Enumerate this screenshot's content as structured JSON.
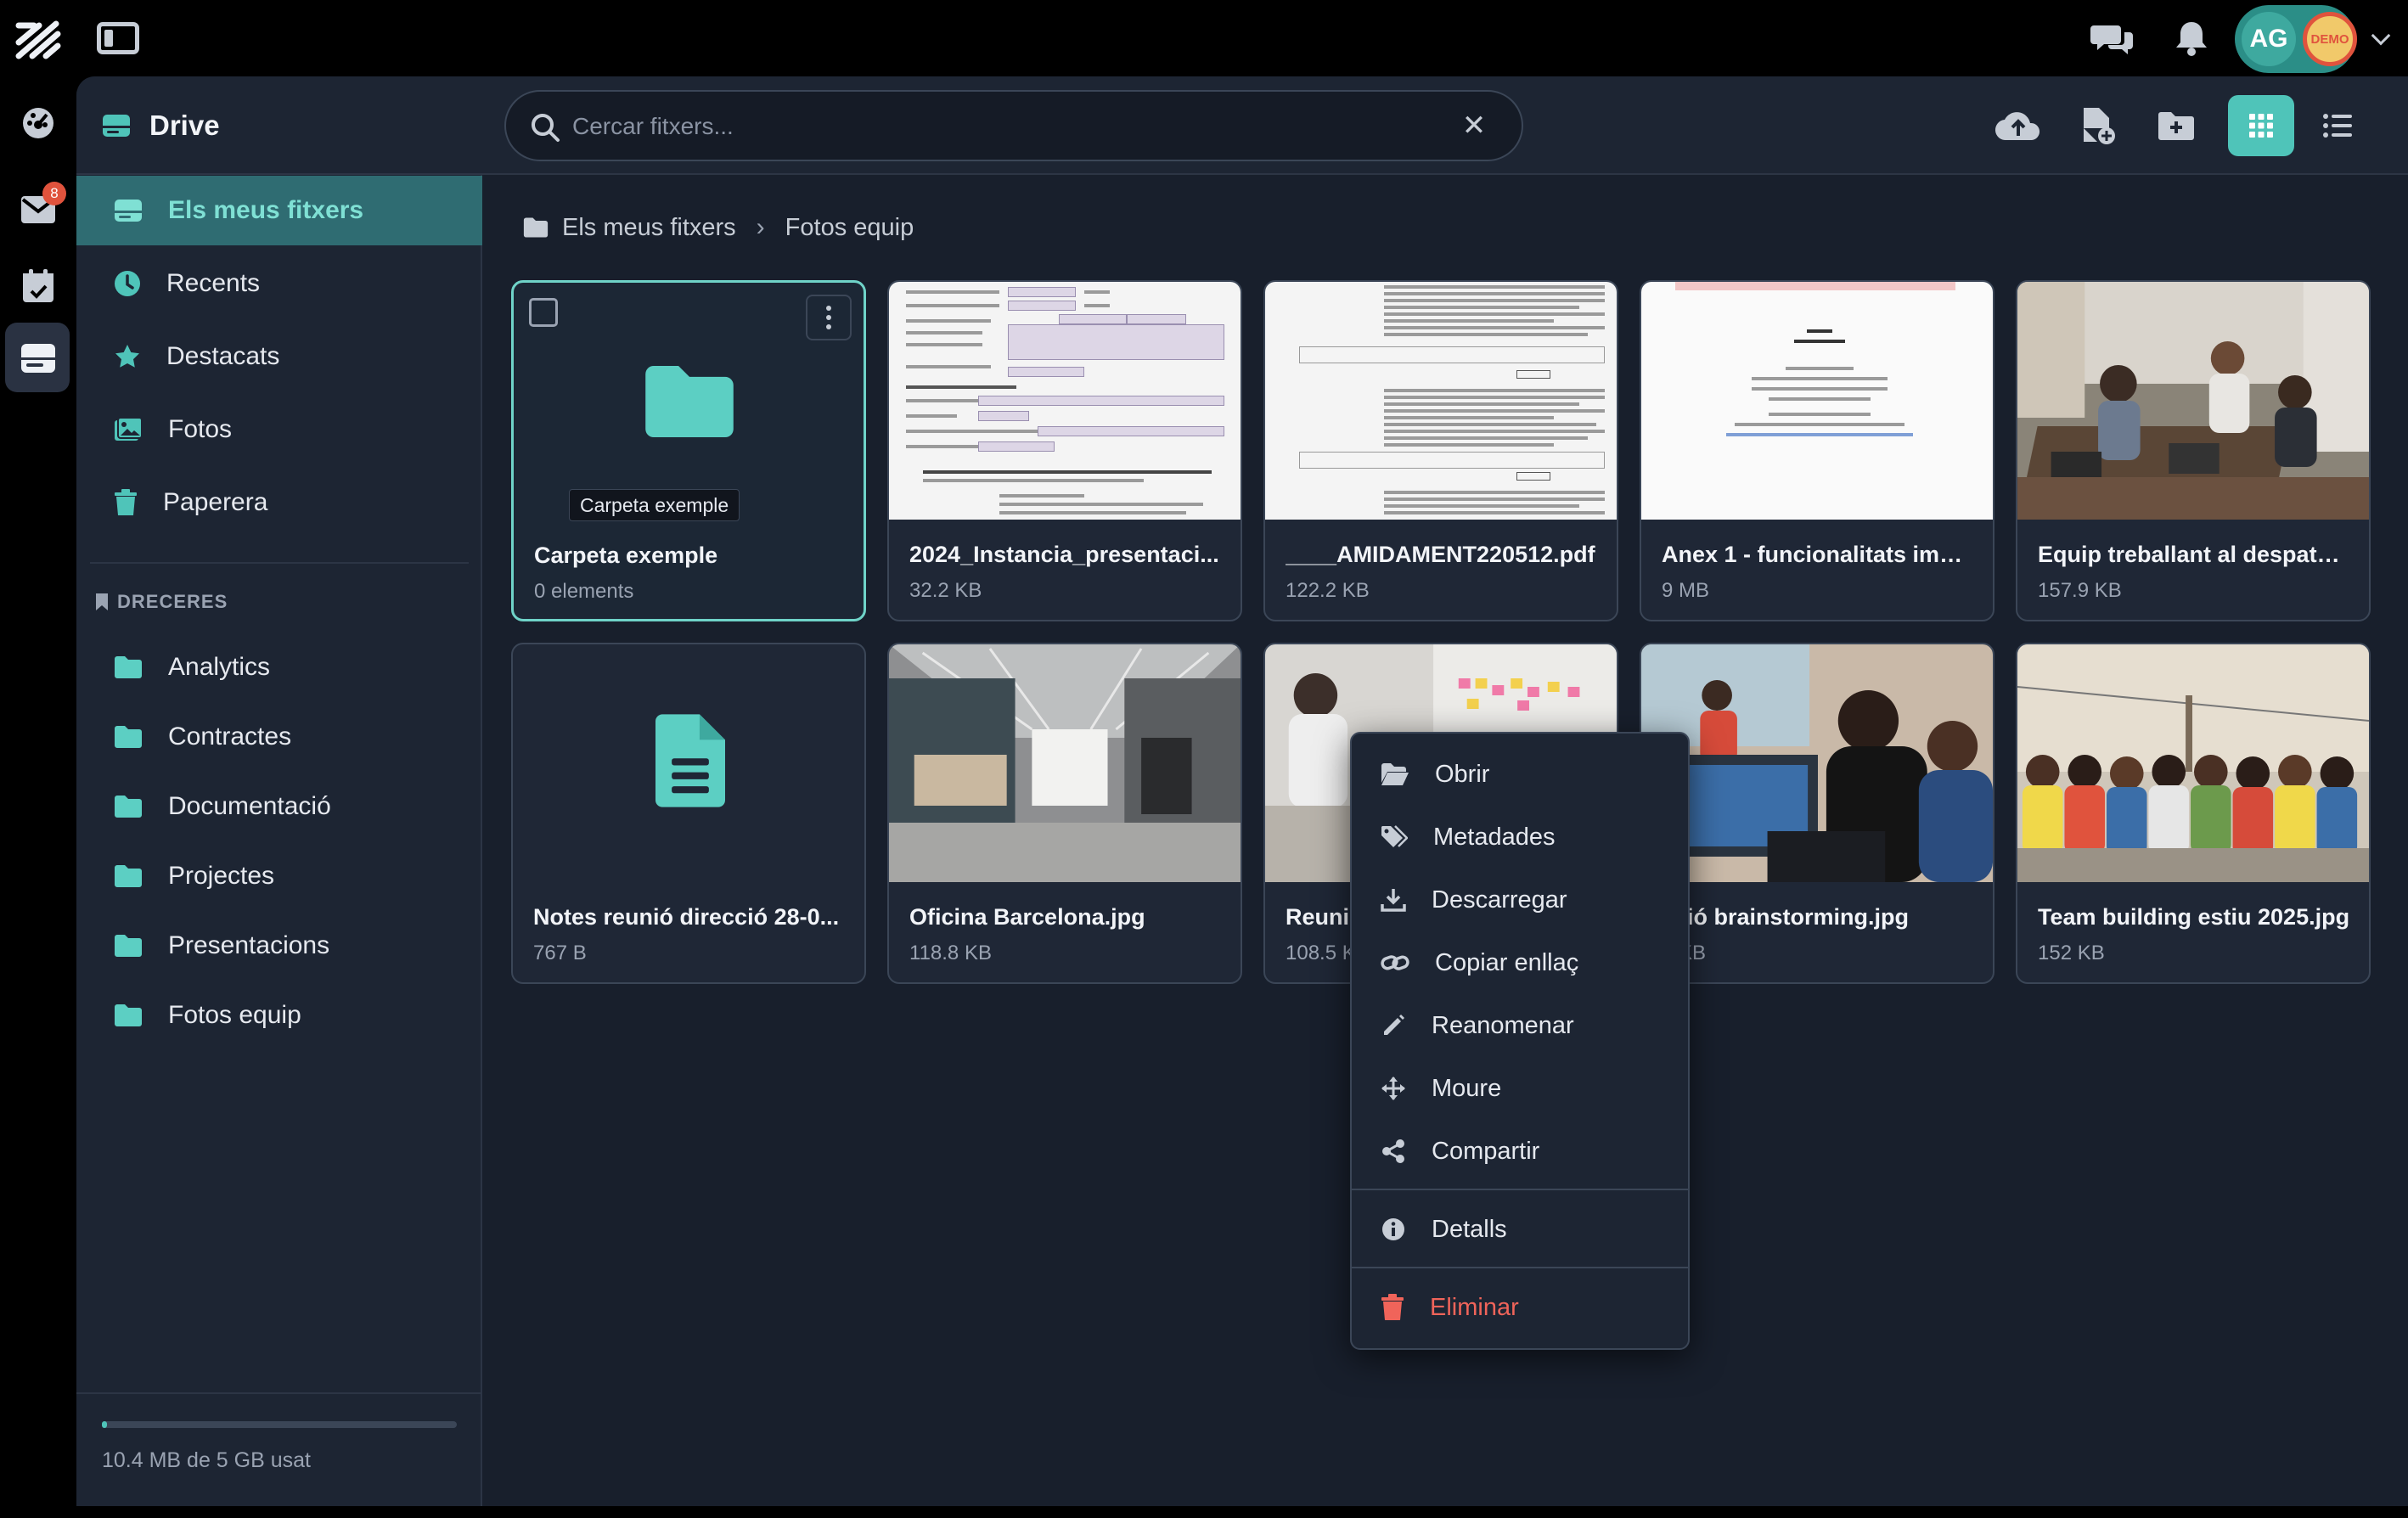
{
  "topbar": {
    "avatar_initials": "AG",
    "demo_label": "DEMO"
  },
  "rail": {
    "mail_badge": "8"
  },
  "header": {
    "app_title": "Drive",
    "search_placeholder": "Cercar fitxers...",
    "search_value": ""
  },
  "sidebar": {
    "items": [
      {
        "label": "Els meus fitxers",
        "icon": "drive-icon",
        "active": true
      },
      {
        "label": "Recents",
        "icon": "clock-icon"
      },
      {
        "label": "Destacats",
        "icon": "star-icon"
      },
      {
        "label": "Fotos",
        "icon": "photos-icon"
      },
      {
        "label": "Paperera",
        "icon": "trash-icon"
      }
    ],
    "shortcuts_heading": "DRECERES",
    "shortcuts": [
      "Analytics",
      "Contractes",
      "Documentació",
      "Projectes",
      "Presentacions",
      "Fotos equip"
    ],
    "quota_text": "10.4 MB de 5 GB usat",
    "quota_fraction": 0.002
  },
  "breadcrumb": [
    "Els meus fitxers",
    "Fotos equip"
  ],
  "files": [
    {
      "name": "Carpeta exemple",
      "meta": "0 elements",
      "kind": "folder"
    },
    {
      "name": "2024_Instancia_presentaci...",
      "meta": "32.2 KB",
      "kind": "doc"
    },
    {
      "name": "____AMIDAMENT220512.pdf",
      "meta": "122.2 KB",
      "kind": "doc"
    },
    {
      "name": "Anex 1 - funcionalitats impl...",
      "meta": "9 MB",
      "kind": "doc"
    },
    {
      "name": "Equip treballant al despatx.j...",
      "meta": "157.9 KB",
      "kind": "photo"
    },
    {
      "name": "Notes reunió direcció 28-0...",
      "meta": "767 B",
      "kind": "note"
    },
    {
      "name": "Oficina Barcelona.jpg",
      "meta": "118.8 KB",
      "kind": "photo"
    },
    {
      "name": "Reunic",
      "meta": "108.5 K",
      "kind": "photo"
    },
    {
      "name": "ssió brainstorming.jpg",
      "meta": "3 KB",
      "kind": "photo"
    },
    {
      "name": "Team building estiu 2025.jpg",
      "meta": "152 KB",
      "kind": "photo"
    }
  ],
  "tooltip": "Carpeta exemple",
  "context_menu": {
    "items": [
      "Obrir",
      "Metadades",
      "Descarregar",
      "Copiar enllaç",
      "Reanomenar",
      "Moure",
      "Compartir"
    ],
    "details": "Detalls",
    "delete": "Eliminar"
  },
  "colors": {
    "accent": "#4fc4b9",
    "danger": "#f0645a",
    "panel": "#181f2c",
    "sidebar": "#1d2533"
  }
}
